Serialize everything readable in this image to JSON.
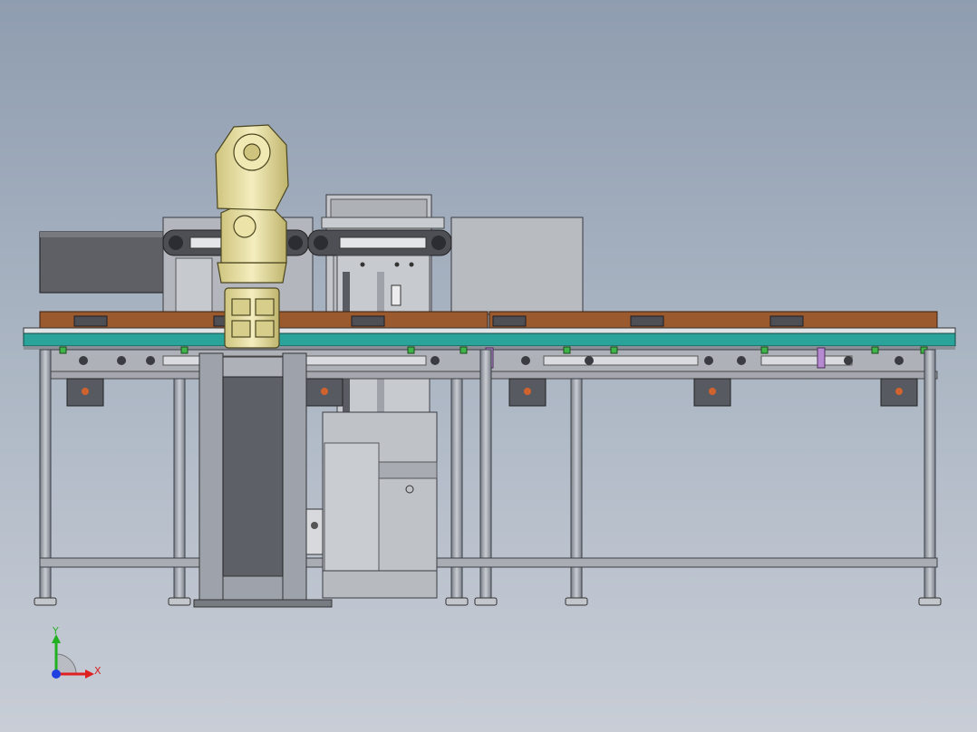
{
  "viewport": {
    "background_top": "#8f9db0",
    "background_bottom": "#c8cdd6"
  },
  "model": {
    "robot_color": "#e9dfa0",
    "conveyor_belt_color": "#2aa39a",
    "pallet_color": "#9a5a2e",
    "frame_color": "#9ea3ab",
    "panel_color": "#5e6068",
    "sensor_color": "#3fb34a",
    "accent_purple": "#b58ad0"
  },
  "triad": {
    "x_label": "X",
    "y_label": "Y",
    "x_color": "#e02020",
    "y_color": "#20b020",
    "z_color": "#2040e0"
  }
}
